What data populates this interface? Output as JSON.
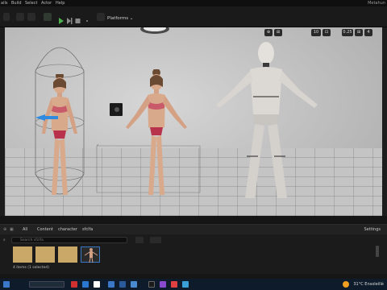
{
  "menu": {
    "items": [
      "ails",
      "Build",
      "Select",
      "Actor",
      "Help"
    ],
    "window_title": "Metahun"
  },
  "toolbar": {
    "platforms_label": "Platforms ⌄"
  },
  "viewport": {
    "chips": [
      "⊕",
      "⊞",
      "10",
      "⊡",
      "0.25",
      "⊞",
      "4"
    ]
  },
  "content_browser": {
    "breadcrumb": [
      "All",
      "Content",
      "character",
      "sfclfa"
    ],
    "settings_label": "Settings",
    "search_placeholder": "Search sfclfa",
    "items_count": "4 items (1 selected)"
  },
  "taskbar": {
    "weather": "31°C Ensoleillé"
  },
  "icons": {
    "play": "play-icon",
    "search": "search-icon",
    "folder": "folder-icon",
    "sun": "sun-icon"
  }
}
